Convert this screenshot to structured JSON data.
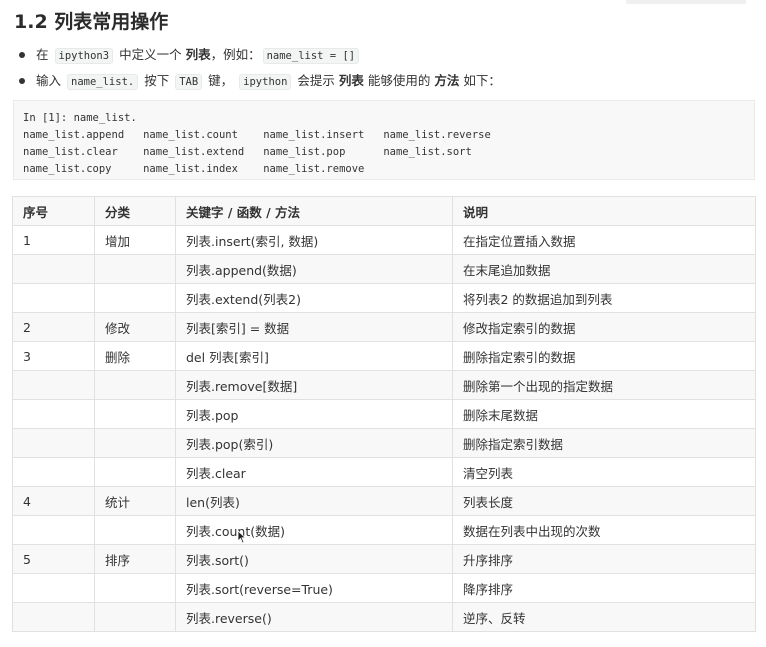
{
  "heading": "1.2 列表常用操作",
  "bullets": [
    {
      "pre": "在",
      "code1": "ipython3",
      "mid": "中定义一个",
      "bold1": "列表",
      "post": "，例如：",
      "code2": "name_list = []"
    },
    {
      "pre": "输入",
      "code1": "name_list.",
      "mid1": "按下",
      "code2": "TAB",
      "mid2": "键，",
      "code3": "ipython",
      "mid3": "会提示",
      "bold1": "列表",
      "mid4": "能够使用的",
      "bold2": "方法",
      "post": "如下："
    }
  ],
  "code_block": "In [1]: name_list.\nname_list.append   name_list.count    name_list.insert   name_list.reverse\nname_list.clear    name_list.extend   name_list.pop      name_list.sort\nname_list.copy     name_list.index    name_list.remove",
  "table": {
    "headers": [
      "序号",
      "分类",
      "关键字 / 函数 / 方法",
      "说明"
    ],
    "rows": [
      [
        "1",
        "增加",
        "列表.insert(索引, 数据)",
        "在指定位置插入数据"
      ],
      [
        "",
        "",
        "列表.append(数据)",
        "在末尾追加数据"
      ],
      [
        "",
        "",
        "列表.extend(列表2)",
        "将列表2 的数据追加到列表"
      ],
      [
        "2",
        "修改",
        "列表[索引] = 数据",
        "修改指定索引的数据"
      ],
      [
        "3",
        "删除",
        "del 列表[索引]",
        "删除指定索引的数据"
      ],
      [
        "",
        "",
        "列表.remove[数据]",
        "删除第一个出现的指定数据"
      ],
      [
        "",
        "",
        "列表.pop",
        "删除末尾数据"
      ],
      [
        "",
        "",
        "列表.pop(索引)",
        "删除指定索引数据"
      ],
      [
        "",
        "",
        "列表.clear",
        "清空列表"
      ],
      [
        "4",
        "统计",
        "len(列表)",
        "列表长度"
      ],
      [
        "",
        "",
        "列表.count(数据)",
        "数据在列表中出现的次数"
      ],
      [
        "5",
        "排序",
        "列表.sort()",
        "升序排序"
      ],
      [
        "",
        "",
        "列表.sort(reverse=True)",
        "降序排序"
      ],
      [
        "",
        "",
        "列表.reverse()",
        "逆序、反转"
      ]
    ]
  }
}
